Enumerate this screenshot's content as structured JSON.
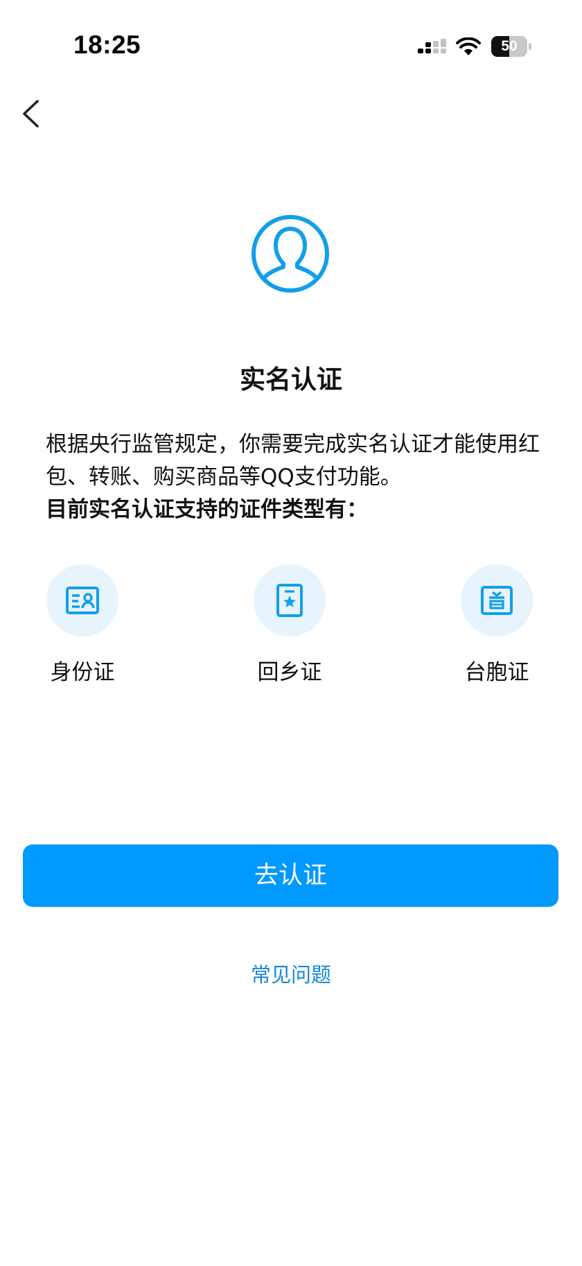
{
  "status_bar": {
    "time": "18:25",
    "battery_level": "50",
    "battery_percent": 50,
    "signal_icon": "cellular-signal-icon",
    "wifi_icon": "wifi-icon"
  },
  "nav": {
    "back_icon": "chevron-left-icon"
  },
  "header": {
    "avatar_icon": "user-outline-icon",
    "title": "实名认证"
  },
  "description": {
    "text": "根据央行监管规定，你需要完成实名认证才能使用红包、转账、购买商品等QQ支付功能。",
    "support_title": "目前实名认证支持的证件类型有："
  },
  "id_types": [
    {
      "label": "身份证",
      "icon": "id-card-icon"
    },
    {
      "label": "回乡证",
      "icon": "home-return-permit-icon"
    },
    {
      "label": "台胞证",
      "icon": "taiwan-compatriot-permit-icon"
    }
  ],
  "actions": {
    "verify_label": "去认证",
    "faq_label": "常见问题"
  },
  "colors": {
    "accent": "#0099FF",
    "icon_blue": "#129FEA",
    "icon_bg": "#E7F3FD",
    "link": "#1487D6"
  }
}
